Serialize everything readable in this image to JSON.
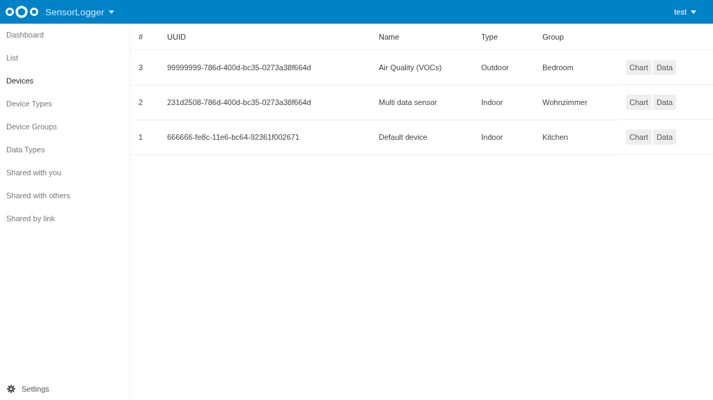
{
  "header": {
    "app_name": "SensorLogger",
    "user": "test"
  },
  "sidebar": {
    "items": [
      {
        "label": "Dashboard",
        "selected": false
      },
      {
        "label": "List",
        "selected": false
      },
      {
        "label": "Devices",
        "selected": true
      },
      {
        "label": "Device Types",
        "selected": false
      },
      {
        "label": "Device Groups",
        "selected": false
      },
      {
        "label": "Data Types",
        "selected": false
      },
      {
        "label": "Shared with you",
        "selected": false
      },
      {
        "label": "Shared with others",
        "selected": false
      },
      {
        "label": "Shared by link",
        "selected": false
      }
    ],
    "settings": "Settings"
  },
  "table": {
    "columns": [
      "#",
      "UUID",
      "Name",
      "Type",
      "Group"
    ],
    "rows": [
      {
        "id": "3",
        "uuid": "99999999-786d-400d-bc35-0273a38f664d",
        "name": "Air Quality (VOCs)",
        "type": "Outdoor",
        "group": "Bedroom",
        "actions": [
          "Chart",
          "Data"
        ]
      },
      {
        "id": "2",
        "uuid": "231d2508-786d-400d-bc35-0273a38f664d",
        "name": "Multi data sensor",
        "type": "Indoor",
        "group": "Wohnzimmer",
        "actions": [
          "Chart",
          "Data"
        ]
      },
      {
        "id": "1",
        "uuid": "666666-fe8c-11e6-bc64-92361f002671",
        "name": "Default device",
        "type": "Indoor",
        "group": "Kitchen",
        "actions": [
          "Chart",
          "Data"
        ]
      }
    ]
  }
}
